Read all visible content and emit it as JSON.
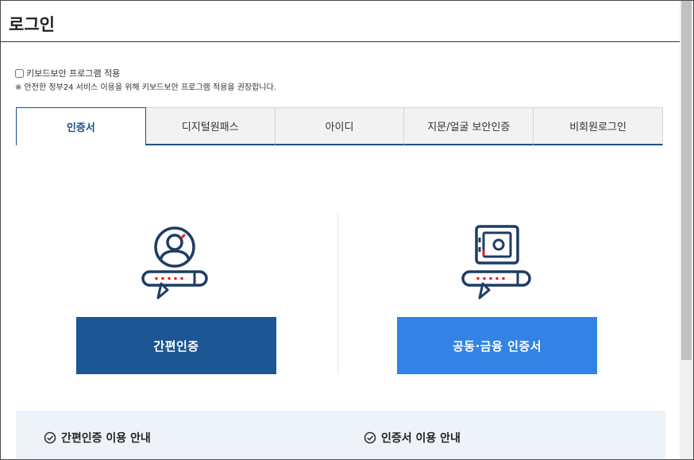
{
  "page": {
    "title": "로그인"
  },
  "keyboard_security": {
    "checkbox_label": "키보드보안 프로그램 적용",
    "notice": "※ 안전한 정부24 서비스 이용을 위해 키보드보안 프로그램 적용을 권장합니다."
  },
  "tabs": [
    {
      "label": "인증서",
      "active": true
    },
    {
      "label": "디지털원패스",
      "active": false
    },
    {
      "label": "아이디",
      "active": false
    },
    {
      "label": "지문/얼굴 보안인증",
      "active": false
    },
    {
      "label": "비회원로그인",
      "active": false
    }
  ],
  "login_options": {
    "easy_auth": {
      "button_label": "간편인증",
      "icon": "person-password-icon",
      "color": "#1d5694"
    },
    "joint_cert": {
      "button_label": "공동·금융 인증서",
      "icon": "safe-password-icon",
      "color": "#3283e5"
    }
  },
  "info": {
    "easy_auth_guide": "간편인증 이용 안내",
    "cert_guide": "인증서 이용 안내"
  },
  "colors": {
    "accent": "#1e4f8a",
    "password_dots": "#e0202e"
  }
}
